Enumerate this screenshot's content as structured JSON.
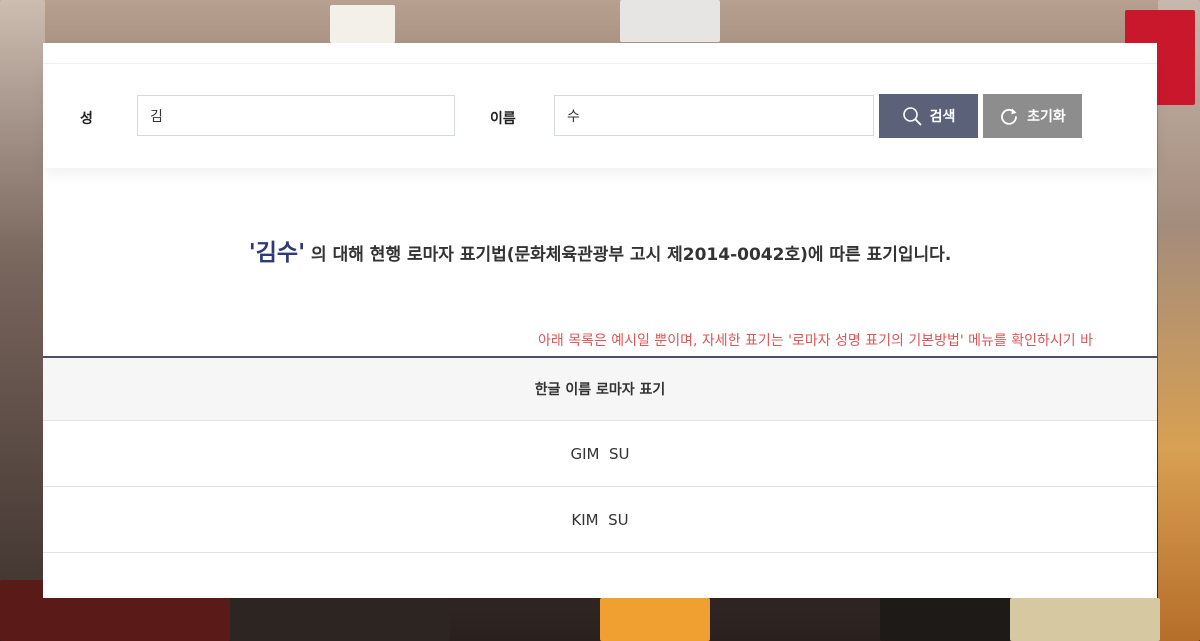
{
  "search": {
    "surname_label": "성",
    "surname_value": "김",
    "given_label": "이름",
    "given_value": "수",
    "search_button": "검색",
    "reset_button": "초기화"
  },
  "result": {
    "highlight": "'김수'",
    "text": " 의 대해 현행 로마자 표기법(문화체육관광부 고시 제2014-0042호)에 따른 표기입니다."
  },
  "notice": "아래 목록은 예시일 뿐이며, 자세한 표기는 '로마자 성명 표기의 기본방법' 메뉴를 확인하시기 바",
  "table": {
    "header": "한글 이름 로마자 표기",
    "rows": [
      "GIM  SU",
      "KIM  SU"
    ]
  },
  "colors": {
    "search_button": "#5b6179",
    "reset_button": "#8d8d8d",
    "highlight": "#2e3a73",
    "notice": "#e05555"
  },
  "icons": {
    "search": "magnifier-icon",
    "reset": "refresh-icon"
  }
}
